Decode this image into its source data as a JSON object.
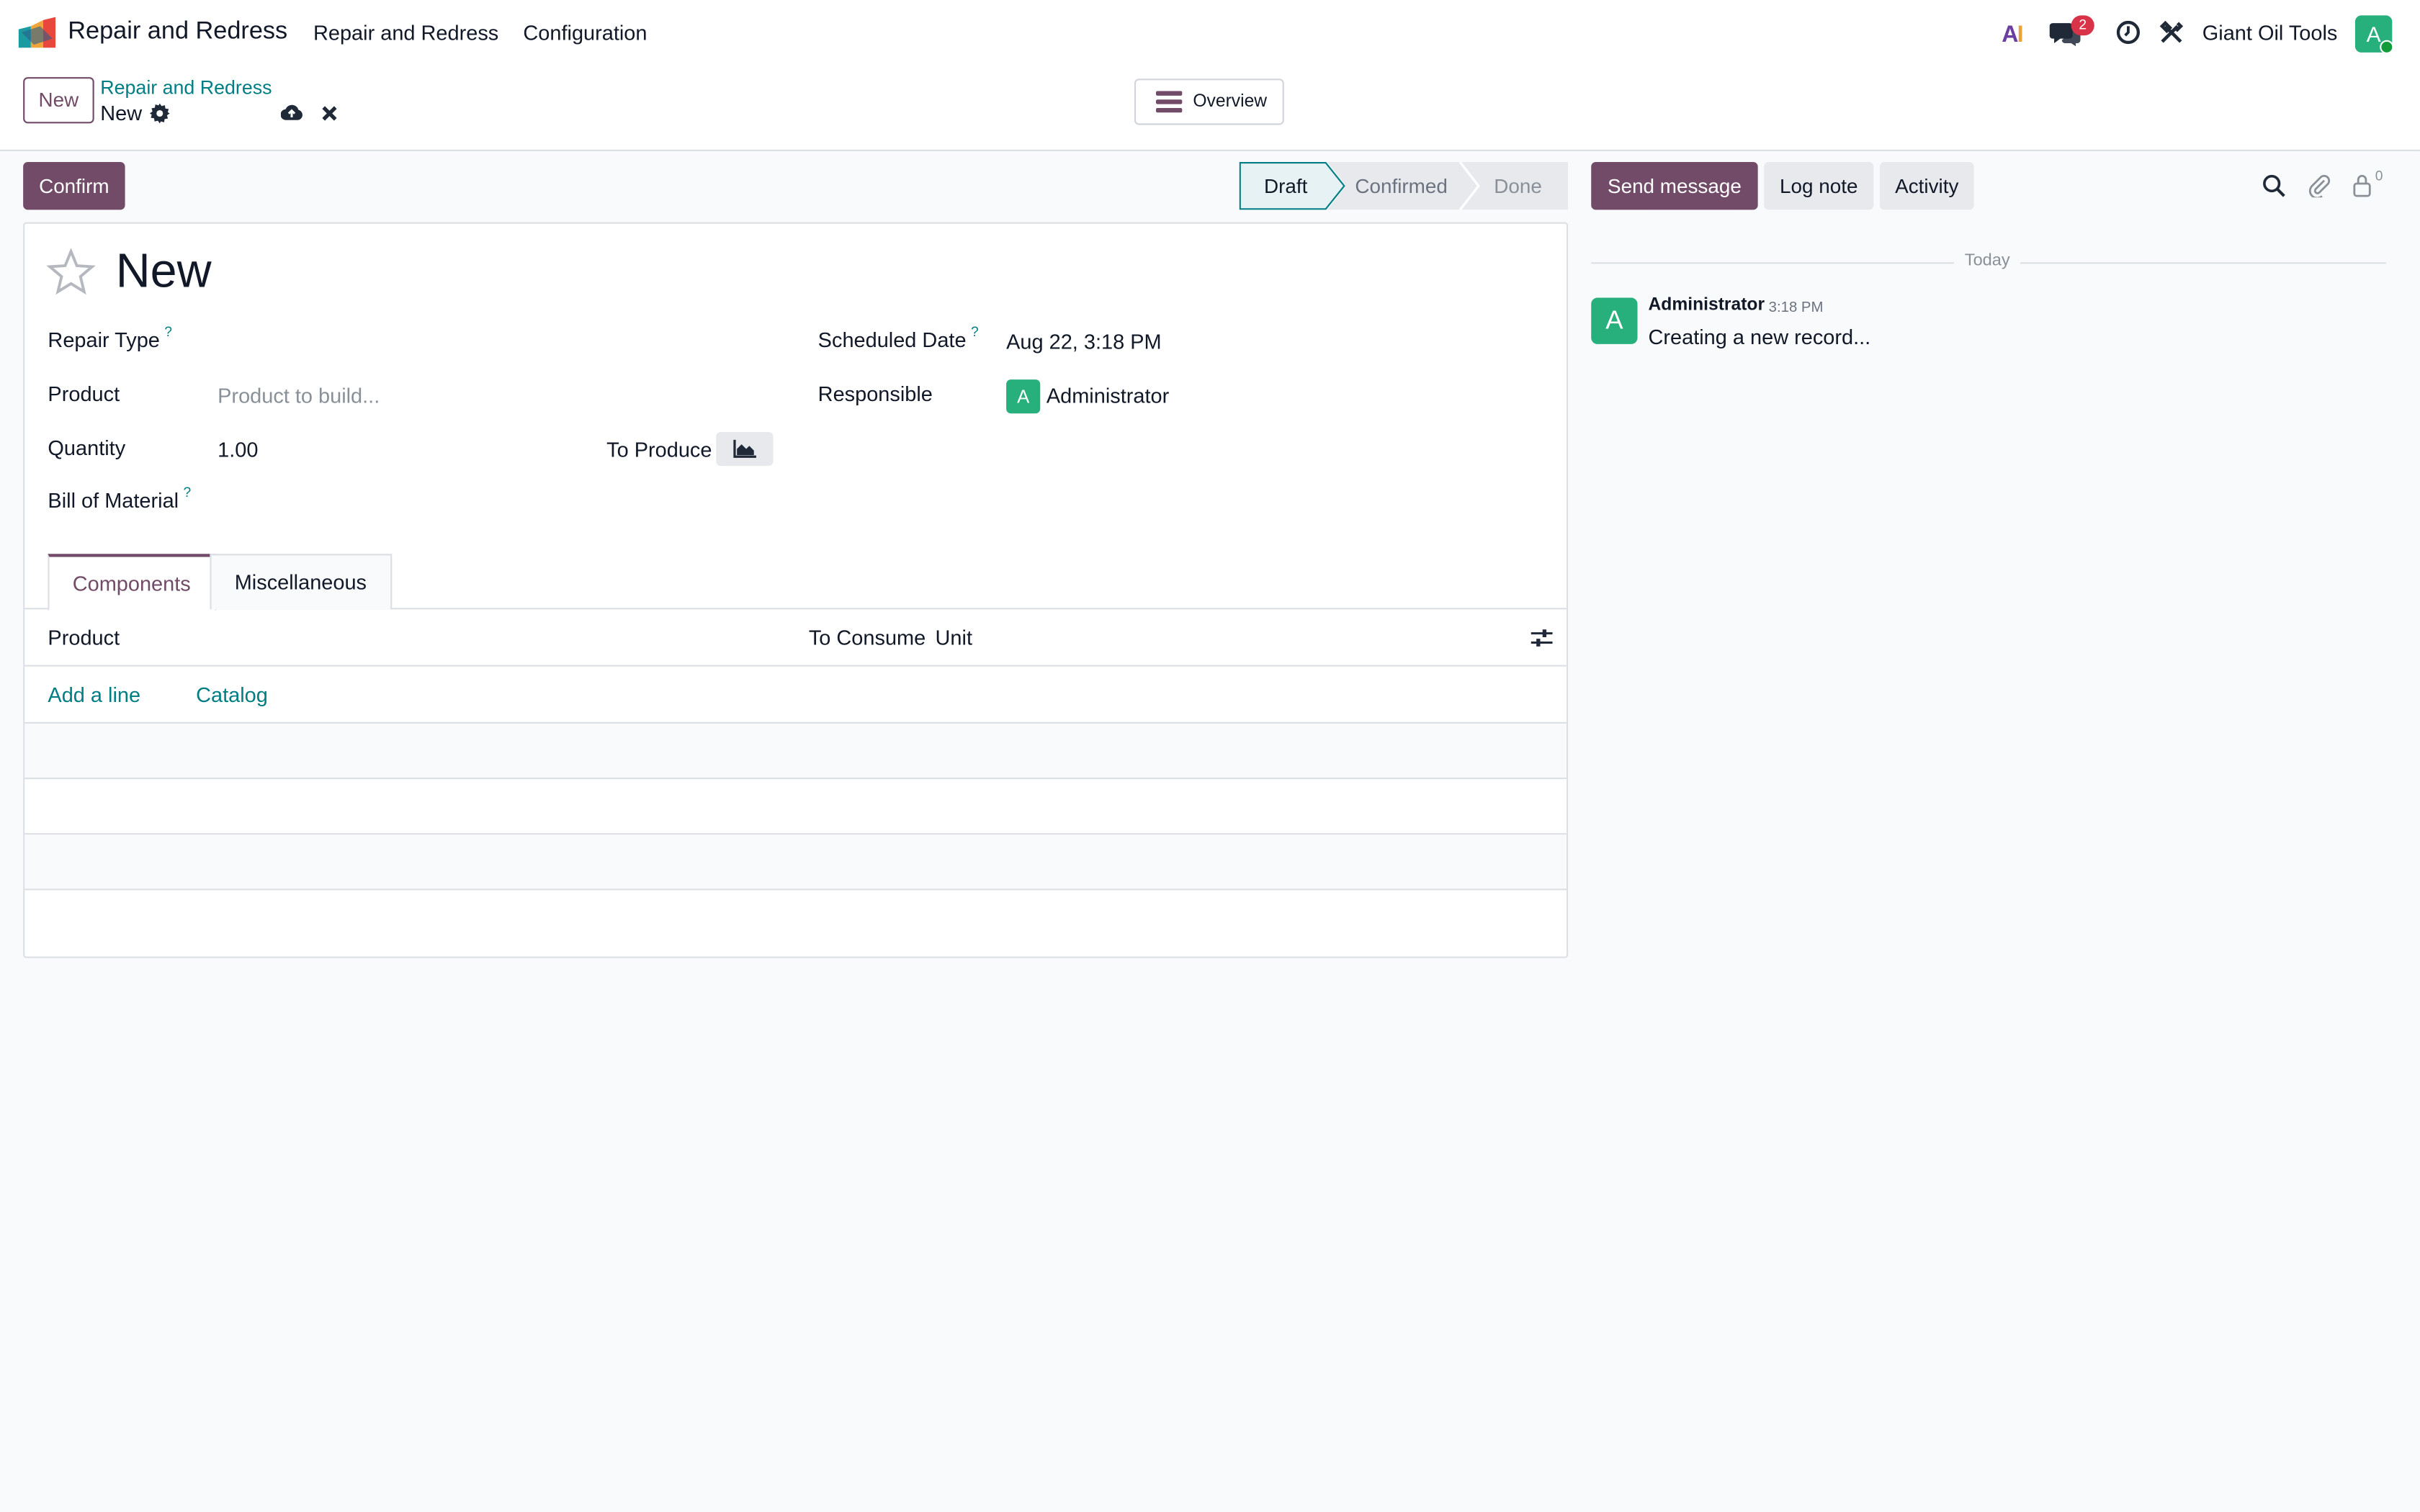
{
  "topnav": {
    "app_name": "Repair and Redress",
    "menu": [
      "Repair and Redress",
      "Configuration"
    ],
    "messages_badge": "2",
    "company": "Giant Oil Tools",
    "user_initial": "A"
  },
  "control": {
    "new_label": "New",
    "breadcrumb_parent": "Repair and Redress",
    "breadcrumb_current": "New",
    "overview_label": "Overview"
  },
  "status": {
    "confirm_label": "Confirm",
    "stages": [
      "Draft",
      "Confirmed",
      "Done"
    ],
    "active_stage": "Draft"
  },
  "form": {
    "title": "New",
    "repair_type_label": "Repair Type",
    "product_label": "Product",
    "product_placeholder": "Product to build...",
    "quantity_label": "Quantity",
    "quantity_value": "1.00",
    "to_produce_label": "To Produce",
    "bom_label": "Bill of Material",
    "scheduled_label": "Scheduled Date",
    "scheduled_value": "Aug 22, 3:18 PM",
    "responsible_label": "Responsible",
    "responsible_initial": "A",
    "responsible_value": "Administrator",
    "help_mark": "?"
  },
  "tabs": [
    "Components",
    "Miscellaneous"
  ],
  "components": {
    "columns": [
      "Product",
      "To Consume",
      "Unit"
    ],
    "add_line": "Add a line",
    "catalog": "Catalog"
  },
  "chatter": {
    "send_message": "Send message",
    "log_note": "Log note",
    "activity": "Activity",
    "followers_count": "0",
    "today": "Today",
    "message": {
      "author_initial": "A",
      "author": "Administrator",
      "time": "3:18 PM",
      "body": "Creating a new record..."
    }
  },
  "colors": {
    "brand": "#714b67",
    "link": "#017e84",
    "avatar": "#27b07c",
    "badge": "#d9334a"
  }
}
